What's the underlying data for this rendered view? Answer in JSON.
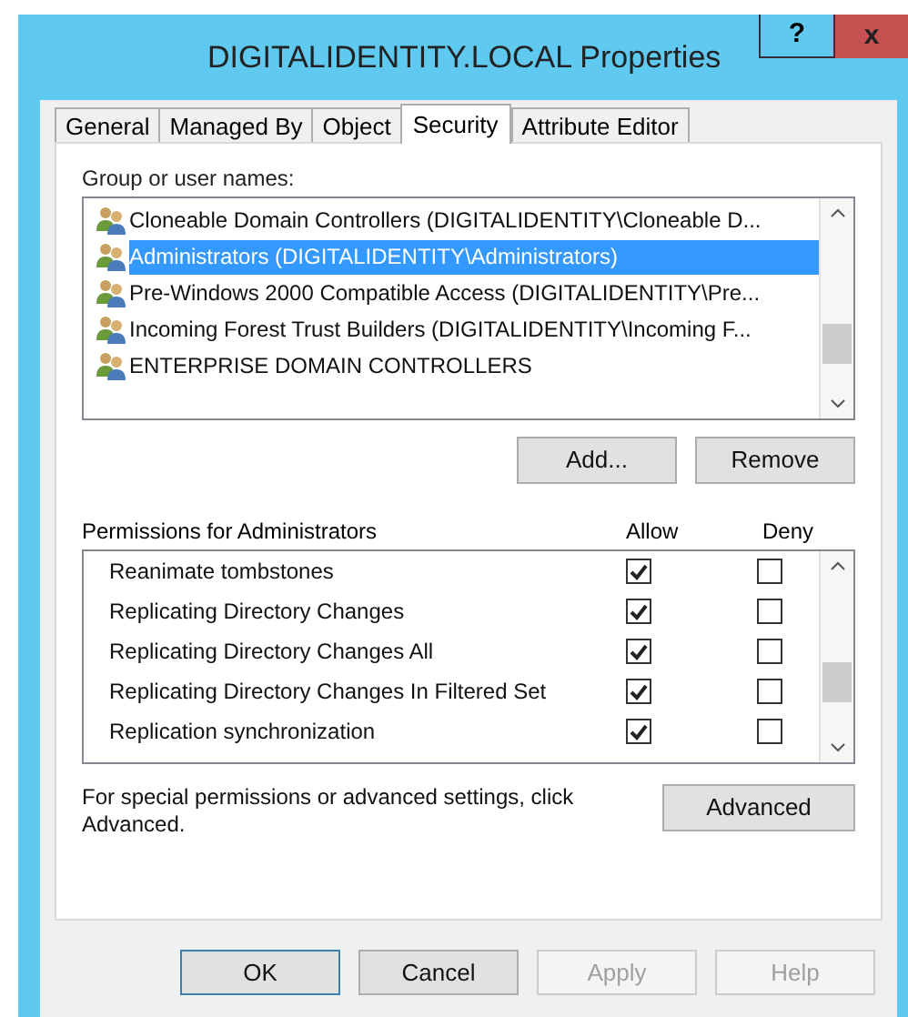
{
  "window": {
    "title": "DIGITALIDENTITY.LOCAL Properties",
    "help_button": "?",
    "close_button": "x"
  },
  "tabs": [
    {
      "label": "General",
      "selected": false
    },
    {
      "label": "Managed By",
      "selected": false
    },
    {
      "label": "Object",
      "selected": false
    },
    {
      "label": "Security",
      "selected": true
    },
    {
      "label": "Attribute Editor",
      "selected": false
    }
  ],
  "group_list": {
    "label": "Group or user names:",
    "items": [
      {
        "name": "Cloneable Domain Controllers (DIGITALIDENTITY\\Cloneable D...",
        "selected": false
      },
      {
        "name": "Administrators (DIGITALIDENTITY\\Administrators)",
        "selected": true
      },
      {
        "name": "Pre-Windows 2000 Compatible Access (DIGITALIDENTITY\\Pre...",
        "selected": false
      },
      {
        "name": "Incoming Forest Trust Builders (DIGITALIDENTITY\\Incoming F...",
        "selected": false
      },
      {
        "name": "ENTERPRISE DOMAIN CONTROLLERS",
        "selected": false
      }
    ]
  },
  "group_buttons": [
    "Add...",
    "Remove"
  ],
  "permissions": {
    "label": "Permissions for Administrators",
    "allow_header": "Allow",
    "deny_header": "Deny",
    "rows": [
      {
        "name": "Reanimate tombstones",
        "allow": true,
        "deny": false
      },
      {
        "name": "Replicating Directory Changes",
        "allow": true,
        "deny": false
      },
      {
        "name": "Replicating Directory Changes All",
        "allow": true,
        "deny": false
      },
      {
        "name": "Replicating Directory Changes In Filtered Set",
        "allow": true,
        "deny": false
      },
      {
        "name": "Replication synchronization",
        "allow": true,
        "deny": false
      }
    ]
  },
  "advanced_note": "For special permissions or advanced settings, click Advanced.",
  "advanced_button": "Advanced",
  "dialog_buttons": [
    {
      "label": "OK",
      "default": true,
      "disabled": false
    },
    {
      "label": "Cancel",
      "default": false,
      "disabled": false
    },
    {
      "label": "Apply",
      "default": false,
      "disabled": true
    },
    {
      "label": "Help",
      "default": false,
      "disabled": true
    }
  ]
}
